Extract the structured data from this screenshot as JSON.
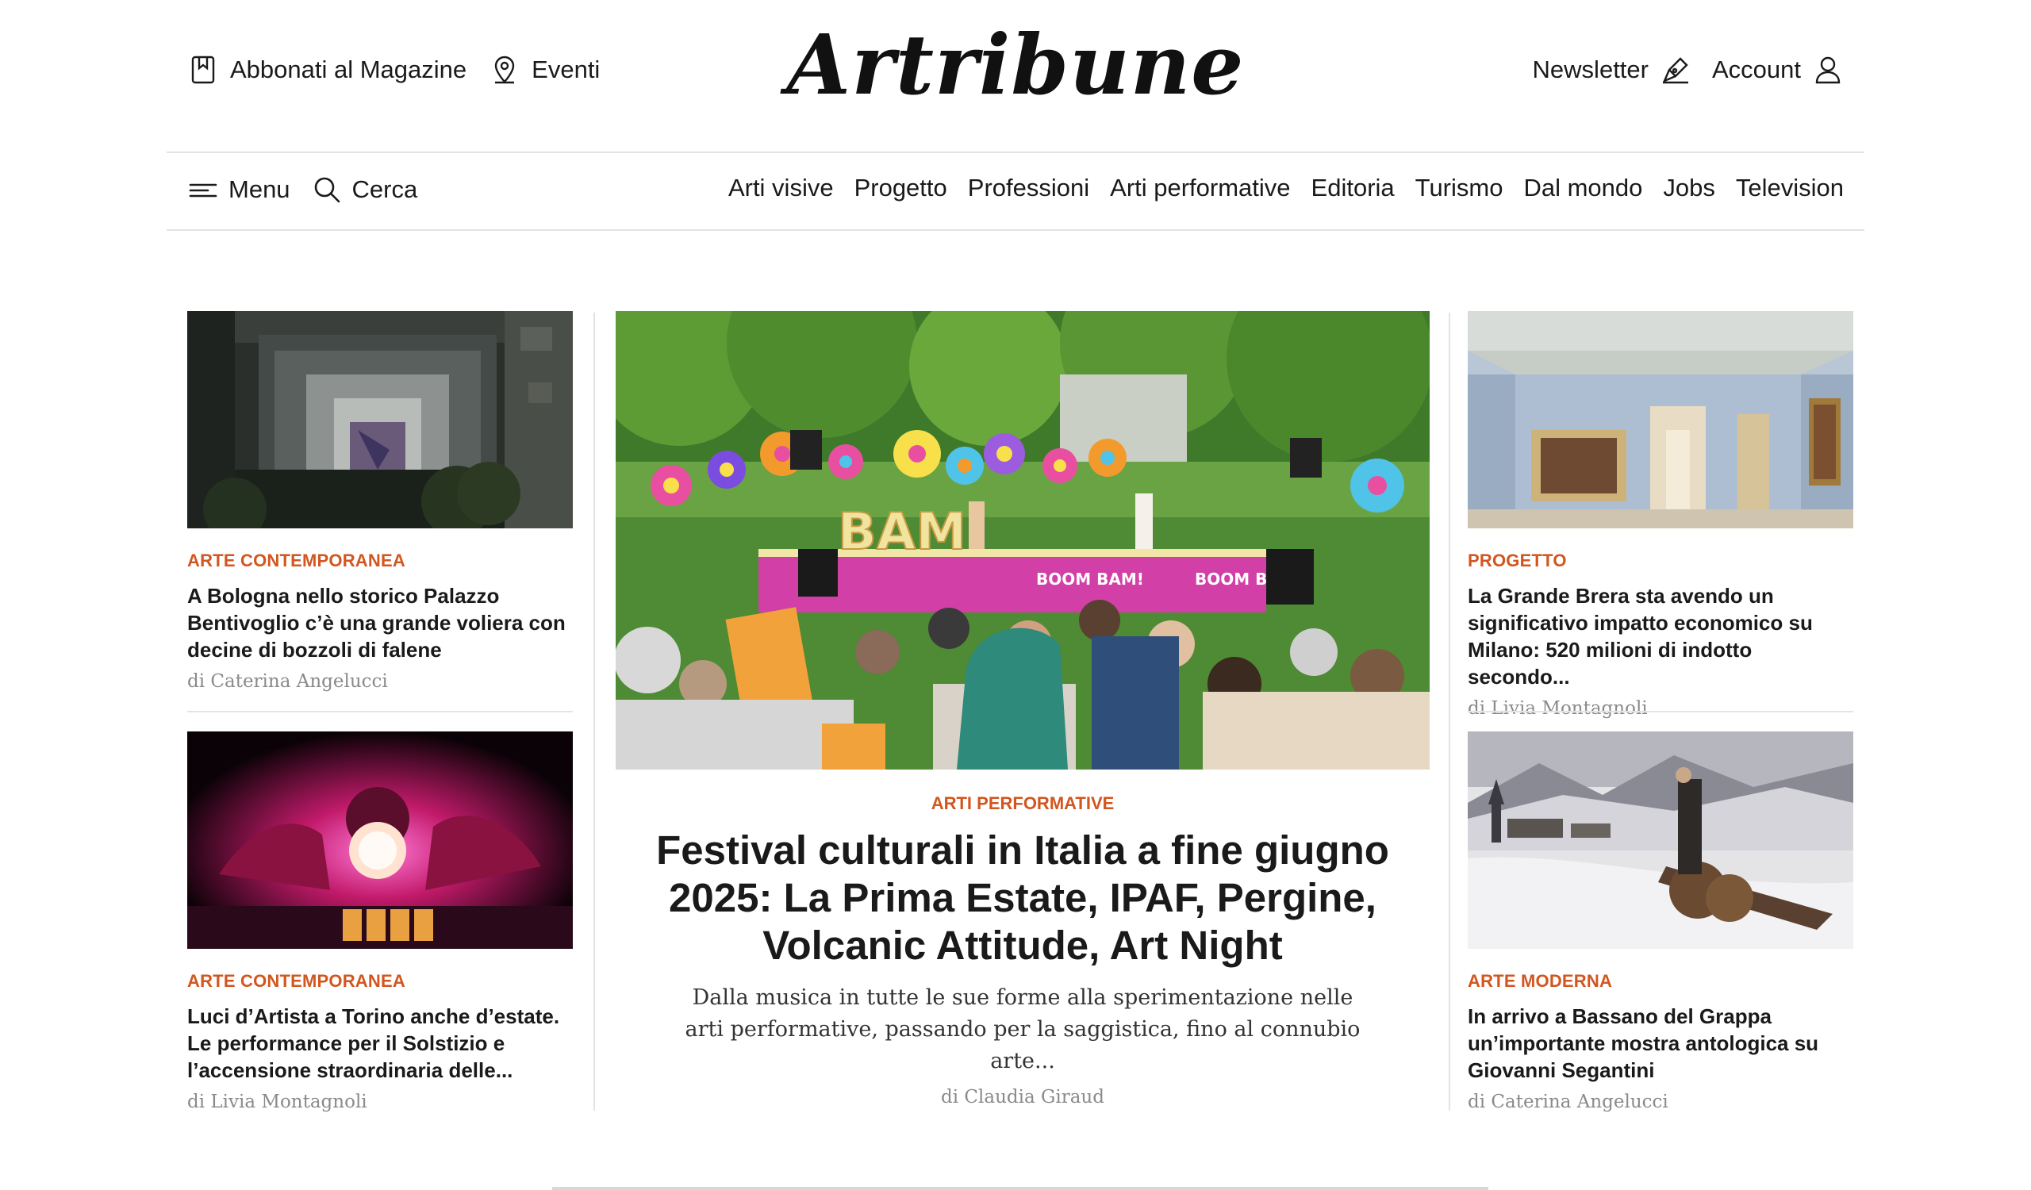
{
  "header": {
    "logo": "Artribune",
    "left_links": [
      {
        "label": "Abbonati al Magazine",
        "icon": "bookmark-icon"
      },
      {
        "label": "Eventi",
        "icon": "location-pin-icon"
      }
    ],
    "right_links": [
      {
        "label": "Newsletter",
        "icon": "newsletter-pen-icon"
      },
      {
        "label": "Account",
        "icon": "user-icon"
      }
    ]
  },
  "nav": {
    "menu_label": "Menu",
    "search_label": "Cerca",
    "sections": [
      "Arti visive",
      "Progetto",
      "Professioni",
      "Arti performative",
      "Editoria",
      "Turismo",
      "Dal mondo",
      "Jobs",
      "Television"
    ]
  },
  "articles": {
    "left_top": {
      "category": "ARTE CONTEMPORANEA",
      "title": "A Bologna nello storico Palazzo Bentivoglio c’è una grande voliera con decine di bozzoli di falene",
      "author": "di Caterina Angelucci"
    },
    "left_bottom": {
      "category": "ARTE CONTEMPORANEA",
      "title": "Luci d’Artista a Torino anche d’estate. Le performance per il Solstizio e l’accensione straordinaria delle...",
      "author": "di Livia Montagnoli"
    },
    "main": {
      "category": "ARTI PERFORMATIVE",
      "headline": "Festival culturali in Italia a fine giugno 2025: La Prima Estate, IPAF, Pergine, Volcanic Attitude, Art Night",
      "deck": "Dalla musica in tutte le sue forme alla sperimentazione nelle arti performative, passando per la saggistica, fino al connubio arte...",
      "author": "di Claudia Giraud",
      "hero_signs": {
        "letters": "BAM",
        "stage_sign": "BOOM BAM!"
      }
    },
    "right_top": {
      "category": "PROGETTO",
      "title": "La Grande Brera sta avendo un significativo impatto economico su Milano: 520 milioni di indotto secondo...",
      "author": "di Livia Montagnoli"
    },
    "right_bottom": {
      "category": "ARTE MODERNA",
      "title": "In arrivo a Bassano del Grappa un’importante mostra antologica su Giovanni Segantini",
      "author": "di Caterina Angelucci"
    }
  },
  "colors": {
    "accent": "#d2561f",
    "divider": "#e3e3e3",
    "text": "#1a1a1a",
    "muted": "#8a8a8a"
  }
}
